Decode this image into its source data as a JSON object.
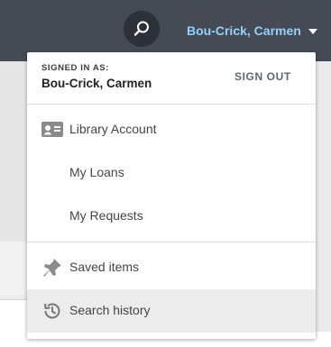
{
  "header": {
    "user_name": "Bou-Crick, Carmen",
    "search_icon": "search-icon"
  },
  "menu": {
    "signed_in_label": "SIGNED IN AS:",
    "signed_in_name": "Bou-Crick, Carmen",
    "sign_out": "SIGN OUT",
    "items": [
      {
        "label": "Library Account",
        "icon": "id-card-icon"
      },
      {
        "label": "My Loans"
      },
      {
        "label": "My Requests"
      },
      {
        "label": "Saved items",
        "icon": "pin-icon"
      },
      {
        "label": "Search history",
        "icon": "history-icon",
        "highlighted": true
      }
    ]
  },
  "colors": {
    "topbar": "#454a54",
    "user_name": "#8ed3ff",
    "highlight": "#ececec"
  }
}
